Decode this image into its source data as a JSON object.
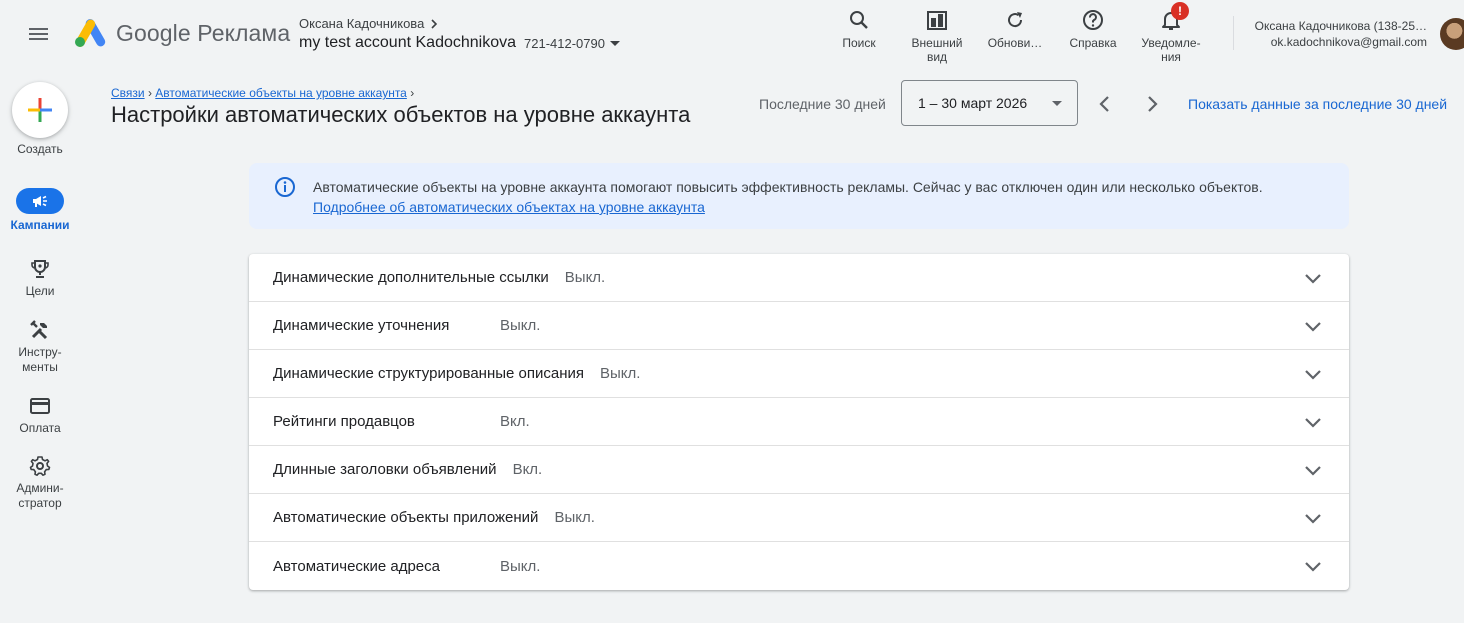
{
  "brand": {
    "name": "Google",
    "product": "Реклама"
  },
  "account": {
    "owner": "Оксана Кадочникова",
    "name": "my test account Kadochnikova",
    "id": "721-412-0790"
  },
  "top_actions": [
    {
      "label": "Поиск",
      "icon": "search-icon"
    },
    {
      "label": "Внешний\nвид",
      "icon": "appearance-icon"
    },
    {
      "label": "Обнови…",
      "icon": "refresh-icon"
    },
    {
      "label": "Справка",
      "icon": "help-icon"
    },
    {
      "label": "Уведомле-\nния",
      "icon": "notifications-icon",
      "badge": "!"
    }
  ],
  "user": {
    "name": "Оксана Кадочникова (138-25…",
    "email": "ok.kadochnikova@gmail.com"
  },
  "sidebar": {
    "create_label": "Создать",
    "items": [
      {
        "label": "Кампании",
        "icon": "megaphone-icon",
        "active": true
      },
      {
        "label": "Цели",
        "icon": "trophy-icon"
      },
      {
        "label": "Инстру-\nменты",
        "icon": "tools-icon"
      },
      {
        "label": "Оплата",
        "icon": "credit-card-icon"
      },
      {
        "label": "Админи-\nстратор",
        "icon": "gear-icon"
      }
    ]
  },
  "breadcrumbs": [
    "Связи",
    "Автоматические объекты на уровне аккаунта"
  ],
  "page_title": "Настройки автоматических объектов на уровне аккаунта",
  "date_range": {
    "label": "Последние 30 дней",
    "value": "1 – 30 март 2026",
    "show_link": "Показать данные за последние 30 дней"
  },
  "banner": {
    "text": "Автоматические объекты на уровне аккаунта помогают повысить эффективность рекламы. Сейчас у вас отключен один или несколько объектов.",
    "link": "Подробнее об автоматических объектах на уровне аккаунта"
  },
  "settings": [
    {
      "name": "Динамические дополнительные ссылки",
      "status": "Выкл.",
      "inline": true
    },
    {
      "name": "Динамические уточнения",
      "status": "Выкл.",
      "inline": false
    },
    {
      "name": "Динамические структурированные описания",
      "status": "Выкл.",
      "inline": true
    },
    {
      "name": "Рейтинги продавцов",
      "status": "Вкл.",
      "inline": false
    },
    {
      "name": "Длинные заголовки объявлений",
      "status": "Вкл.",
      "inline": true
    },
    {
      "name": "Автоматические объекты приложений",
      "status": "Выкл.",
      "inline": true
    },
    {
      "name": "Автоматические адреса",
      "status": "Выкл.",
      "inline": false
    }
  ],
  "colors": {
    "accent": "#1a73e8",
    "link": "#1967d2",
    "banner_bg": "#e8f0fe",
    "page_bg": "#f1f3f4",
    "badge": "#d93025"
  }
}
